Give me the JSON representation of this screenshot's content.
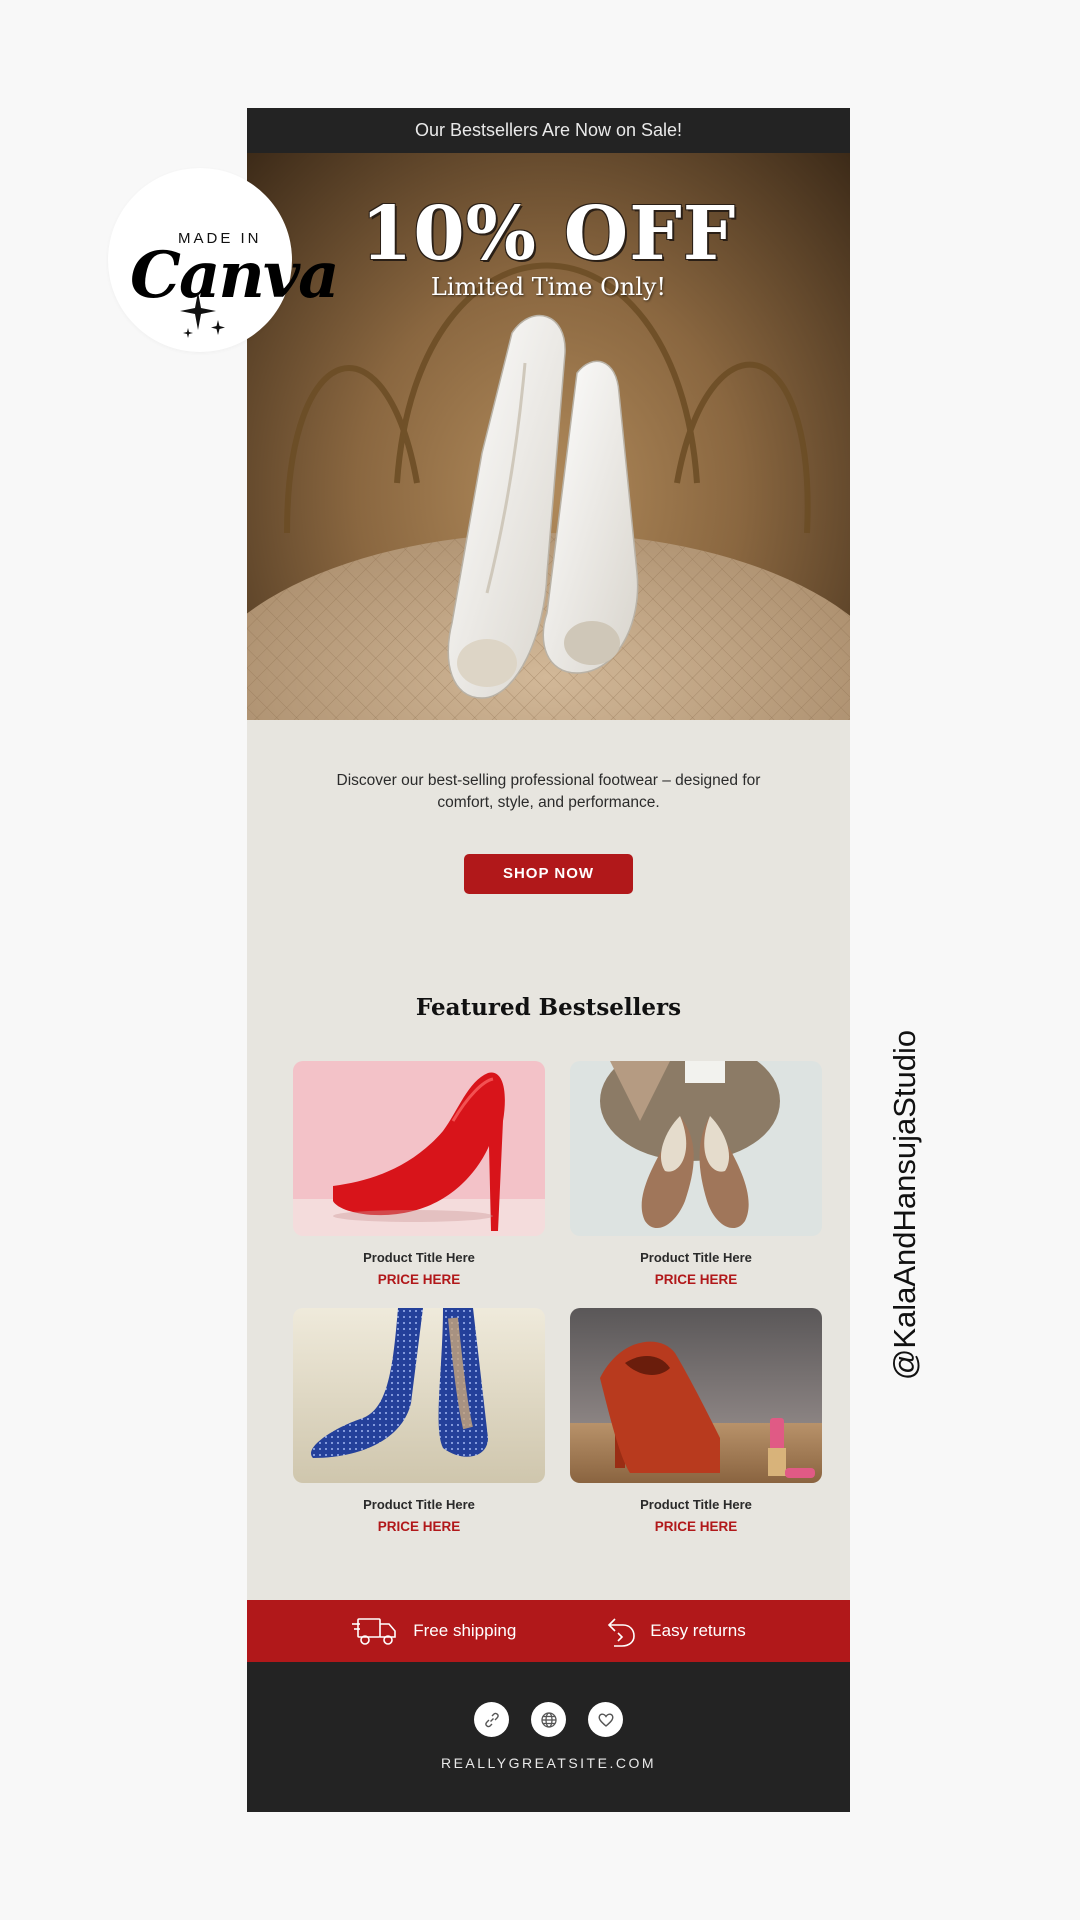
{
  "badge": {
    "made_in": "MADE IN",
    "brand": "Canva"
  },
  "side_handle": "@KalaAndHansujaStudio",
  "email": {
    "top_bar": "Our Bestsellers Are Now on Sale!",
    "hero": {
      "headline": "10% OFF",
      "subheadline": "Limited Time Only!"
    },
    "intro": "Discover our best-selling professional footwear – designed for comfort, style, and performance.",
    "cta_label": "SHOP NOW",
    "section_title": "Featured Bestsellers",
    "products": [
      {
        "title": "Product Title Here",
        "price": "PRICE HERE",
        "image": "red-stiletto-heel-photo"
      },
      {
        "title": "Product Title Here",
        "price": "PRICE HERE",
        "image": "beige-mules-photo"
      },
      {
        "title": "Product Title Here",
        "price": "PRICE HERE",
        "image": "blue-polka-dot-heels-photo"
      },
      {
        "title": "Product Title Here",
        "price": "PRICE HERE",
        "image": "red-platform-heel-with-lipstick-photo"
      }
    ],
    "benefits": [
      {
        "icon": "delivery-truck-icon",
        "label": "Free shipping"
      },
      {
        "icon": "return-arrow-icon",
        "label": "Easy returns"
      }
    ],
    "social_icons": [
      "link-icon",
      "globe-icon",
      "heart-icon"
    ],
    "website": "REALLYGREATSITE.COM"
  },
  "colors": {
    "accent_red": "#b1181a",
    "dark_bar": "#232323",
    "email_background": "#e7e5df",
    "page_background": "#f8f8f8"
  }
}
